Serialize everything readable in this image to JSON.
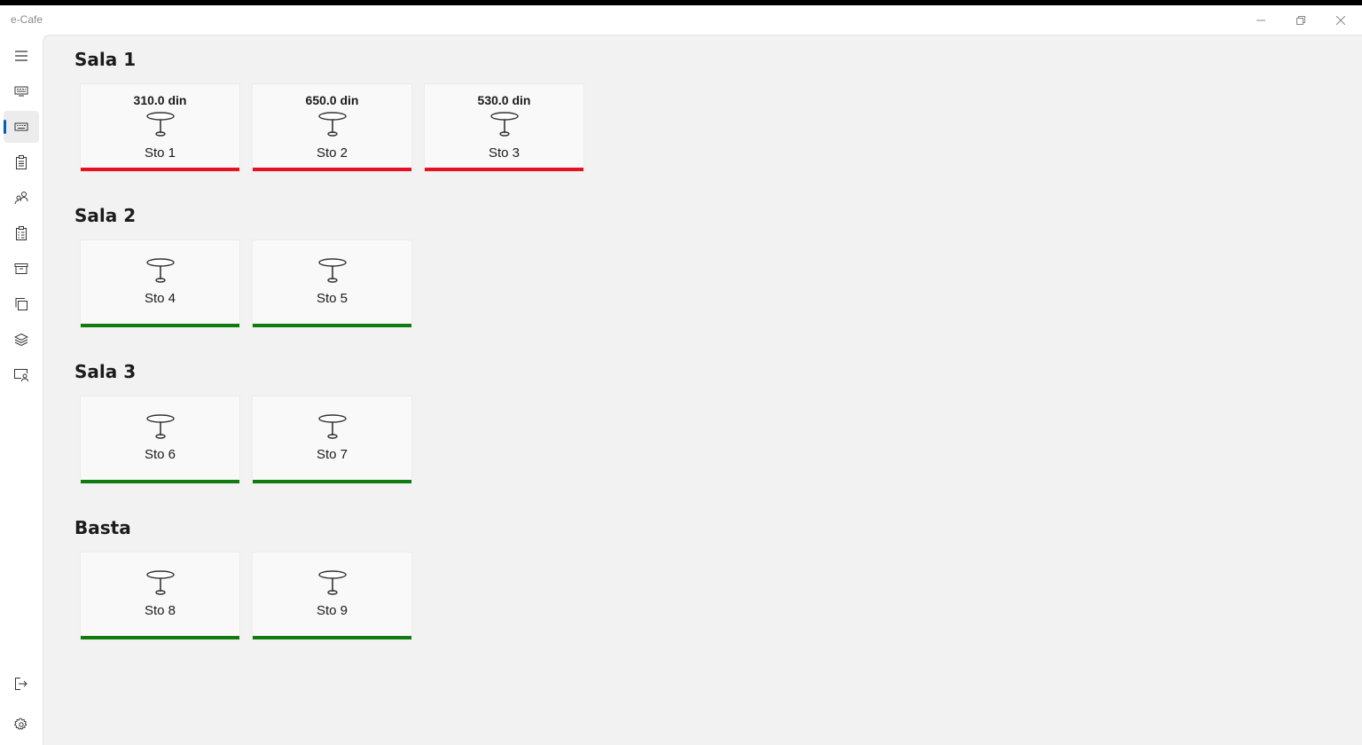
{
  "window": {
    "title": "e-Cafe",
    "controls": [
      "minimize",
      "maximize",
      "close"
    ]
  },
  "nav": {
    "items": [
      {
        "name": "menu-hamburger-icon"
      },
      {
        "name": "register-icon"
      },
      {
        "name": "tables-icon",
        "active": true
      },
      {
        "name": "clipboard-icon"
      },
      {
        "name": "users-icon"
      },
      {
        "name": "checklist-icon"
      },
      {
        "name": "archive-icon"
      },
      {
        "name": "copy-icon"
      },
      {
        "name": "layers-icon"
      },
      {
        "name": "monitor-user-icon"
      }
    ],
    "footer": [
      {
        "name": "logout-icon"
      },
      {
        "name": "settings-icon"
      }
    ]
  },
  "colors": {
    "occupied": "#e81123",
    "free": "#107c10",
    "accent": "#005fb8"
  },
  "sections": [
    {
      "title": "Sala 1",
      "tables": [
        {
          "name": "Sto 1",
          "price": "310.0 din",
          "status": "occupied"
        },
        {
          "name": "Sto 2",
          "price": "650.0 din",
          "status": "occupied"
        },
        {
          "name": "Sto 3",
          "price": "530.0 din",
          "status": "occupied"
        }
      ]
    },
    {
      "title": "Sala 2",
      "tables": [
        {
          "name": "Sto 4",
          "price": "",
          "status": "free"
        },
        {
          "name": "Sto 5",
          "price": "",
          "status": "free"
        }
      ]
    },
    {
      "title": "Sala 3",
      "tables": [
        {
          "name": "Sto 6",
          "price": "",
          "status": "free"
        },
        {
          "name": "Sto 7",
          "price": "",
          "status": "free"
        }
      ]
    },
    {
      "title": "Basta",
      "tables": [
        {
          "name": "Sto 8",
          "price": "",
          "status": "free"
        },
        {
          "name": "Sto 9",
          "price": "",
          "status": "free"
        }
      ]
    }
  ]
}
